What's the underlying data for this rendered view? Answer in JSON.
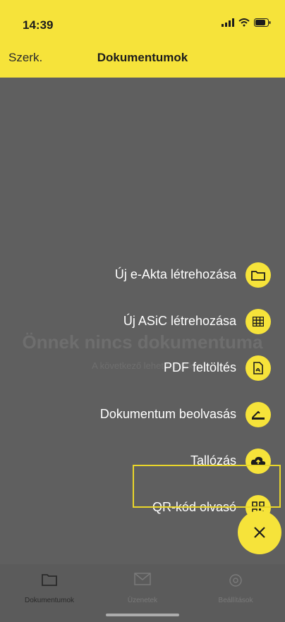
{
  "status": {
    "time": "14:39"
  },
  "nav": {
    "left_label": "Szerk.",
    "title": "Dokumentumok"
  },
  "empty_state": {
    "title": "Önnek nincs dokumentuma",
    "subtitle": "A következő lehetőségek"
  },
  "menu": {
    "items": [
      {
        "label": "Új e-Akta létrehozása",
        "icon": "folder-icon"
      },
      {
        "label": "Új ASiC létrehozása",
        "icon": "grid-icon"
      },
      {
        "label": "PDF feltöltés",
        "icon": "pdf-icon"
      },
      {
        "label": "Dokumentum beolvasás",
        "icon": "scanner-icon"
      },
      {
        "label": "Tallózás",
        "icon": "cloud-icon"
      },
      {
        "label": "QR-kód olvasó",
        "icon": "qr-code-icon"
      }
    ]
  },
  "tabbar": {
    "tabs": [
      {
        "label": "Dokumentumok",
        "icon": "folder-icon",
        "active": true
      },
      {
        "label": "Üzenetek",
        "icon": "mail-icon",
        "active": false
      },
      {
        "label": "Beállítások",
        "icon": "gear-icon",
        "active": false
      }
    ]
  },
  "colors": {
    "accent": "#f6e33a",
    "overlay": "#5f5f5f",
    "text_on_overlay": "#ffffff",
    "dark": "#1c1c1c"
  }
}
